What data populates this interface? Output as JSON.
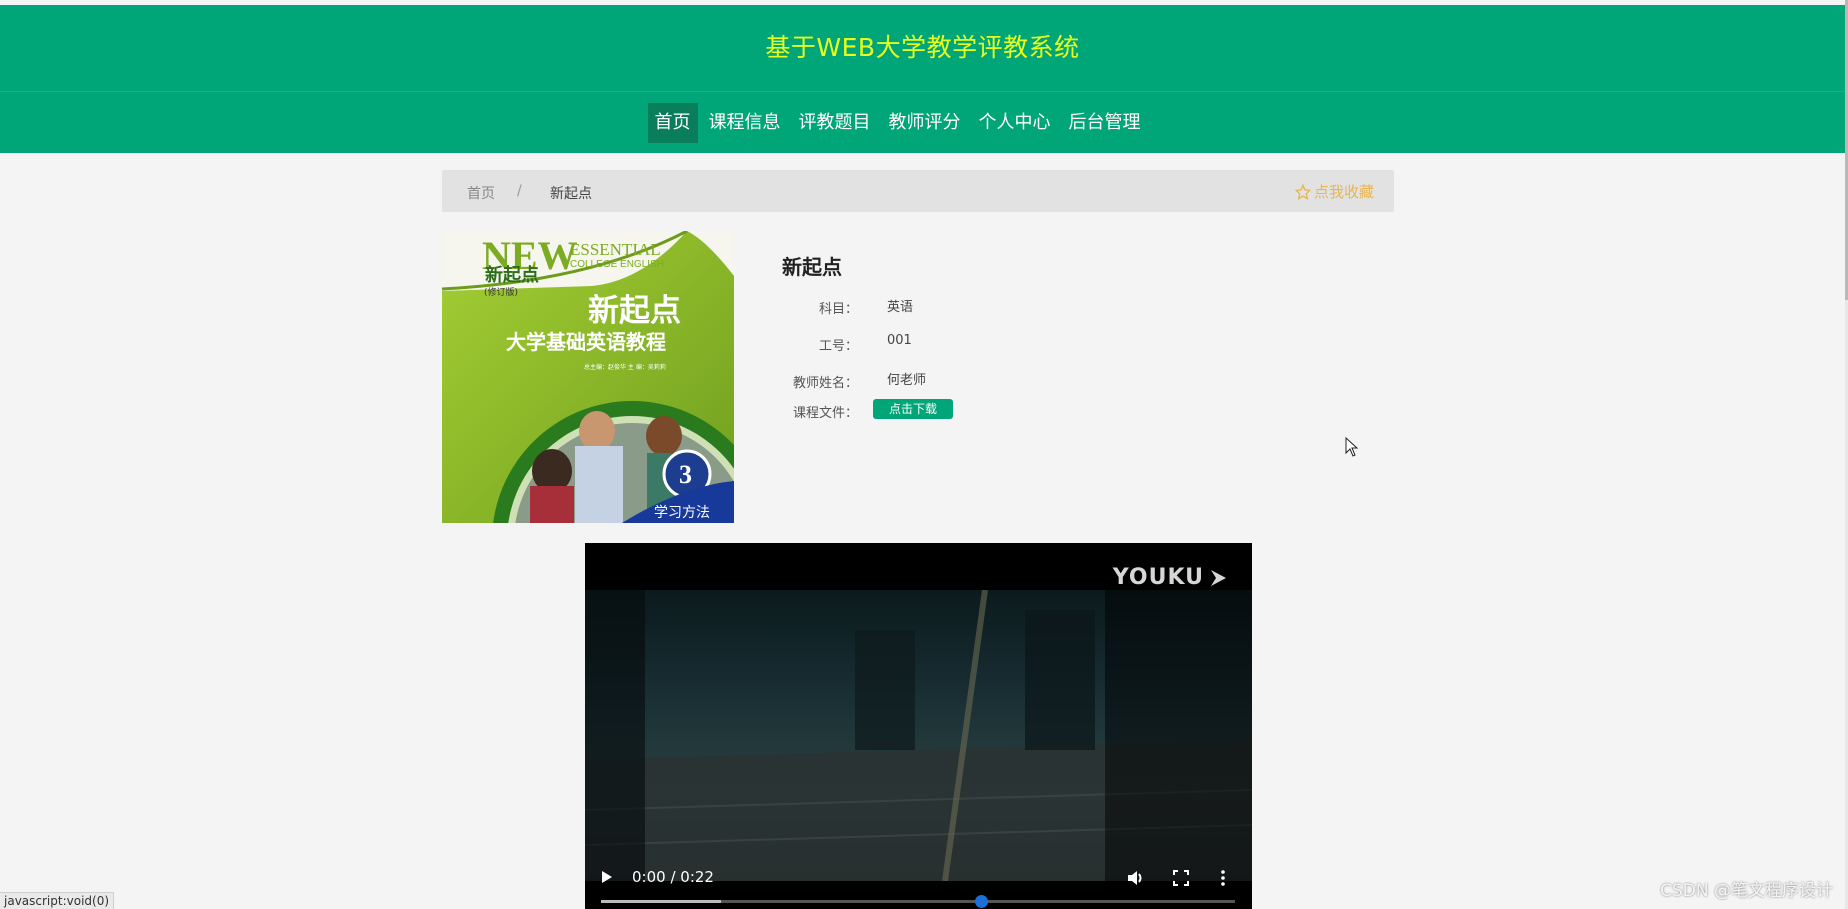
{
  "header": {
    "site_title": "基于WEB大学教学评教系统"
  },
  "nav": {
    "items": [
      {
        "label": "首页",
        "active": true
      },
      {
        "label": "课程信息",
        "active": false
      },
      {
        "label": "评教题目",
        "active": false
      },
      {
        "label": "教师评分",
        "active": false
      },
      {
        "label": "个人中心",
        "active": false
      },
      {
        "label": "后台管理",
        "active": false
      }
    ]
  },
  "breadcrumb": {
    "home": "首页",
    "separator": "/",
    "current": "新起点",
    "favorite_label": "点我收藏"
  },
  "cover": {
    "brand_new": "NEW",
    "brand_essential": "ESSENTIAL",
    "brand_college": "COLLEGE ENGLISH",
    "series_name": "新起点",
    "edition": "(修订版)",
    "title_main": "新起点",
    "title_sub": "大学基础英语教程",
    "authors": "总主编：赵俊华   主   编：吴莉莉",
    "volume": "3",
    "ribbon": "学习方法"
  },
  "detail": {
    "title": "新起点",
    "fields": [
      {
        "label": "科目：",
        "value": "英语"
      },
      {
        "label": "工号：",
        "value": "001"
      },
      {
        "label": "教师姓名：",
        "value": "何老师"
      },
      {
        "label": "课程文件：",
        "value": ""
      }
    ],
    "download_label": "点击下载"
  },
  "video": {
    "logo_text": "YOUKU",
    "time": "0:00 / 0:22",
    "buffered_fraction": 0.19,
    "knob_fraction": 0.6
  },
  "status_bar": {
    "link": "javascript:void(0)"
  },
  "watermark": "CSDN @笔文程序设计",
  "colors": {
    "primary": "#00a578",
    "title_yellow": "#e6ff1d",
    "favorite": "#e8b64d"
  }
}
